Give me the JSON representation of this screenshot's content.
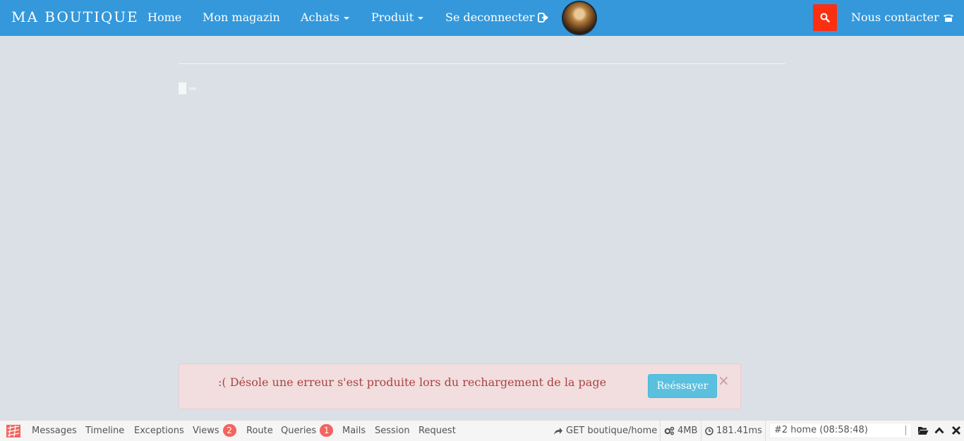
{
  "navbar": {
    "brand": "MA BOUTIQUE",
    "items": [
      {
        "label": "Home"
      },
      {
        "label": "Mon magazin"
      },
      {
        "label": "Achats"
      },
      {
        "label": "Produit"
      },
      {
        "label": "Se deconnecter"
      }
    ],
    "contact_label": "Nous contacter",
    "search_color": "#fc2f11",
    "bar_color": "#3498db"
  },
  "alert": {
    "message": ":( Désole une erreur s'est produite lors du rechargement de la page",
    "retry_label": "Reéssayer",
    "close_symbol": "×"
  },
  "debugbar": {
    "tabs": [
      {
        "label": "Messages"
      },
      {
        "label": "Timeline"
      },
      {
        "label": "Exceptions"
      },
      {
        "label": "Views",
        "badge": "2"
      },
      {
        "label": "Route"
      },
      {
        "label": "Queries",
        "badge": "1"
      },
      {
        "label": "Mails"
      },
      {
        "label": "Session"
      },
      {
        "label": "Request"
      }
    ],
    "route": "GET boutique/home",
    "memory": "4MB",
    "time": "181.41ms",
    "selected_request": "#2 home (08:58:48)"
  }
}
